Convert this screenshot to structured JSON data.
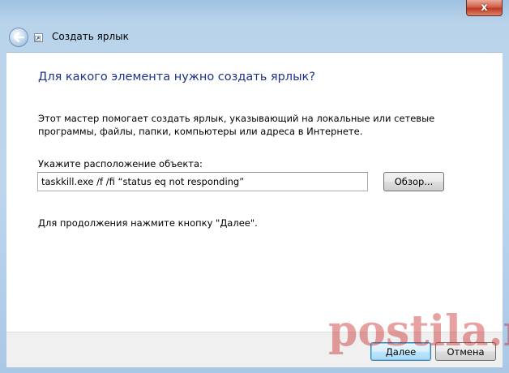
{
  "window": {
    "title": "Создать ярлык",
    "close_glyph": "x"
  },
  "icons": {
    "back": "back-arrow-icon",
    "wizard": "shortcut-icon",
    "close": "close-icon"
  },
  "page": {
    "heading": "Для какого элемента нужно создать ярлык?",
    "description": "Этот мастер помогает создать ярлык, указывающий на локальные или сетевые программы, файлы, папки, компьютеры или адреса в Интернете.",
    "location_label": "Укажите расположение объекта:",
    "location_value": "taskkill.exe /f /fi “status eq not responding”",
    "browse_label": "Обзор...",
    "hint": "Для продолжения нажмите кнопку \"Далее\"."
  },
  "footer": {
    "next_label": "Далее",
    "cancel_label": "Отмена"
  },
  "watermark": "postila.ru",
  "colors": {
    "heading": "#1e3287",
    "frame": "#bcd6ee",
    "close": "#c23a22",
    "watermark": "#c81e1e"
  }
}
